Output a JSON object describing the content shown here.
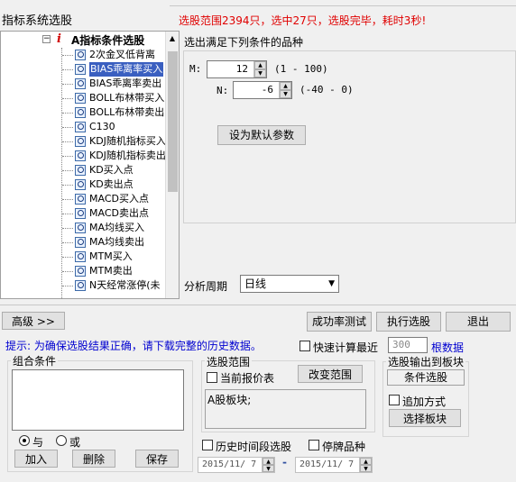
{
  "header": {
    "title": "指标系统选股",
    "status": "选股范围2394只，选中27只，选股完毕，耗时3秒!"
  },
  "tree": {
    "root_label": "A指标条件选股",
    "items": [
      {
        "label": "2次金叉低背离",
        "selected": false
      },
      {
        "label": "BIAS乖离率买入",
        "selected": true
      },
      {
        "label": "BIAS乖离率卖出",
        "selected": false
      },
      {
        "label": "BOLL布林带买入",
        "selected": false
      },
      {
        "label": "BOLL布林带卖出",
        "selected": false
      },
      {
        "label": "C130",
        "selected": false
      },
      {
        "label": "KDJ随机指标买入",
        "selected": false
      },
      {
        "label": "KDJ随机指标卖出",
        "selected": false
      },
      {
        "label": "KD买入点",
        "selected": false
      },
      {
        "label": "KD卖出点",
        "selected": false
      },
      {
        "label": "MACD买入点",
        "selected": false
      },
      {
        "label": "MACD卖出点",
        "selected": false
      },
      {
        "label": "MA均线买入",
        "selected": false
      },
      {
        "label": "MA均线卖出",
        "selected": false
      },
      {
        "label": "MTM买入",
        "selected": false
      },
      {
        "label": "MTM卖出",
        "selected": false
      },
      {
        "label": "N天经常涨停(未",
        "selected": false
      }
    ]
  },
  "params": {
    "heading": "选出满足下列条件的品种",
    "m_label": "M:",
    "m_value": "12",
    "m_range": "(1 - 100)",
    "n_label": "N:",
    "n_value": "-6",
    "n_range": "(-40 - 0)",
    "default_button": "设为默认参数"
  },
  "period": {
    "label": "分析周期",
    "value": "日线"
  },
  "buttons": {
    "advanced": "高级 >>",
    "success_test": "成功率测试",
    "run": "执行选股",
    "exit": "退出"
  },
  "hint": {
    "text": "提示: 为确保选股结果正确，请下载完整的历史数据。",
    "fast_calc": "快速计算最近",
    "fast_value": "300",
    "fast_unit": "根数据"
  },
  "combo": {
    "title": "组合条件",
    "and_label": "与",
    "or_label": "或",
    "add": "加入",
    "delete": "删除",
    "save": "保存"
  },
  "range": {
    "title": "选股范围",
    "current_quote": "当前报价表",
    "change_range": "改变范围",
    "board_text": "A股板块;",
    "history_period": "历史时间段选股",
    "suspended": "停牌品种",
    "date_from": "2015/11/ 7",
    "date_sep": "-",
    "date_to": "2015/11/ 7"
  },
  "output": {
    "title": "选股输出到板块",
    "condition": "条件选股",
    "append_mode": "追加方式",
    "choose_board": "选择板块"
  }
}
